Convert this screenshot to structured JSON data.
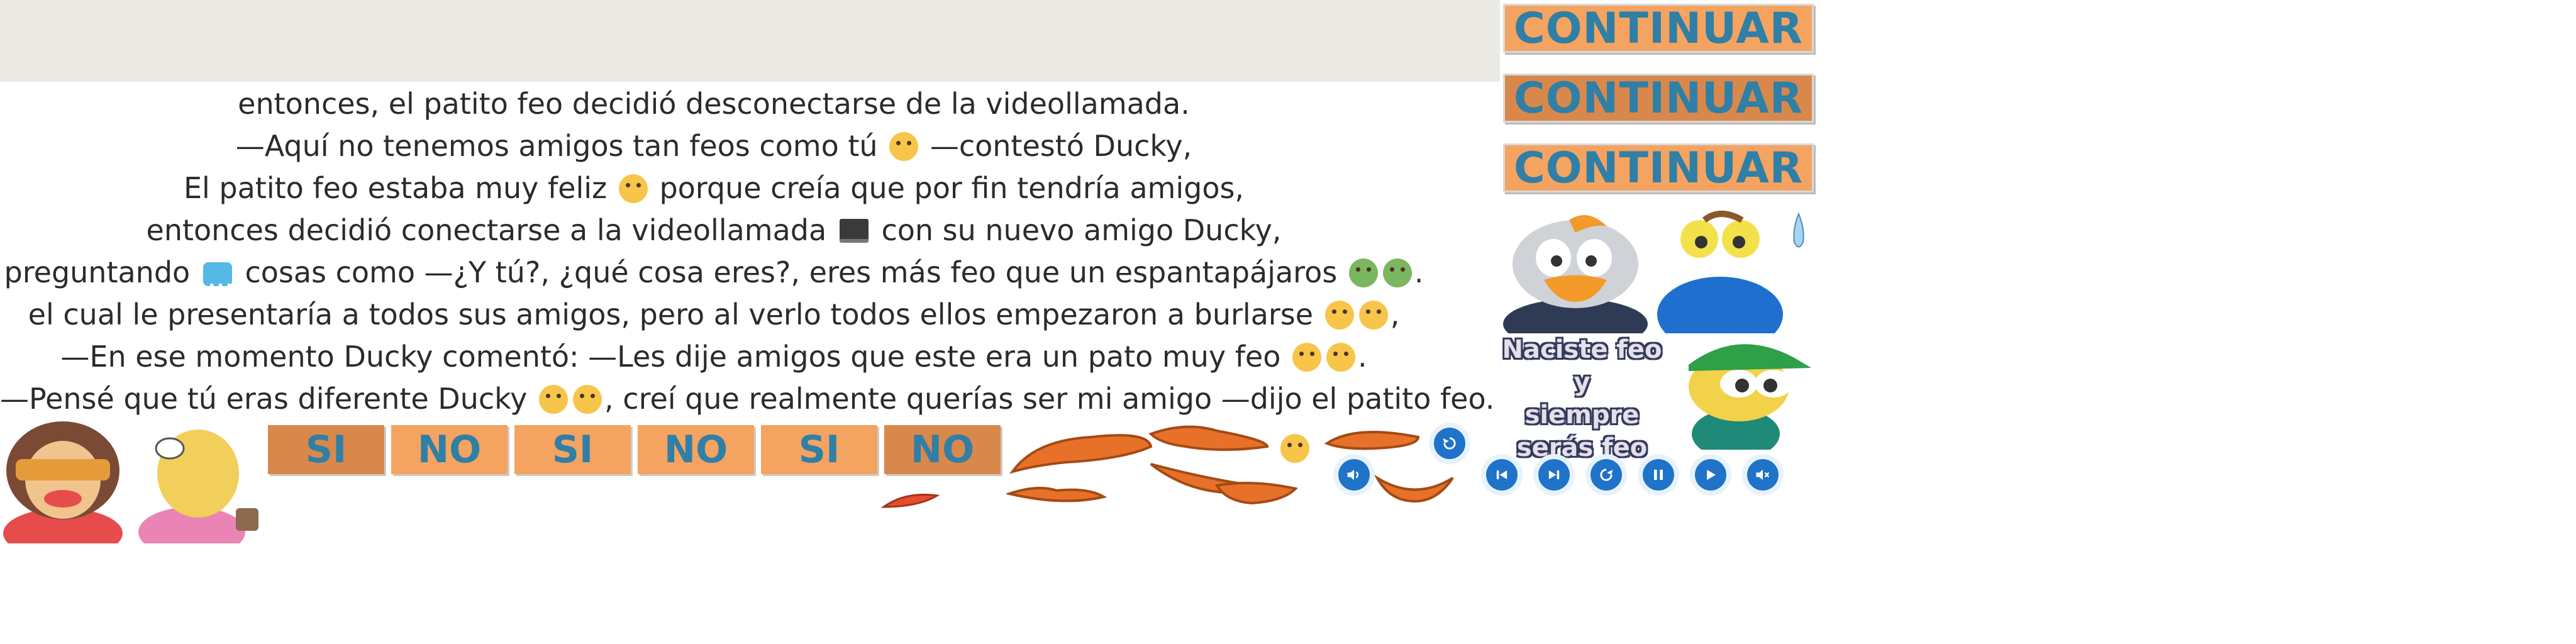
{
  "story": {
    "lines": [
      "entonces, el patito feo decidió desconectarse de la videollamada.",
      "—Aquí no tenemos amigos tan feos como tú",
      "—contestó Ducky,",
      "El patito feo estaba muy feliz",
      "porque creía que por fin tendría amigos,",
      "entonces decidió conectarse a la videollamada",
      "con su nuevo amigo Ducky,",
      "preguntando",
      "cosas como —¿Y tú?, ¿qué cosa eres?, eres más feo que un espantapájaros",
      ".",
      "el cual le presentaría a todos sus amigos, pero al verlo todos ellos empezaron a burlarse",
      ",",
      "—En ese momento Ducky comentó: —Les dije amigos que este era un pato muy feo",
      ".",
      "—Pensé que tú eras diferente Ducky",
      ", creí que realmente querías ser mi amigo —dijo el patito feo."
    ]
  },
  "buttons": {
    "continuar": [
      "CONTINUAR",
      "CONTINUAR",
      "CONTINUAR"
    ],
    "answers": [
      "SI",
      "NO",
      "SI",
      "NO",
      "SI",
      "NO"
    ]
  },
  "speech_bubble": "Naciste feo y\nsiempre\nserás feo",
  "colors": {
    "orange_light": "#f4a360",
    "orange_dark": "#d9884c",
    "button_text": "#2f7fa6",
    "control_blue": "#1f73c8"
  },
  "icons": [
    "volume-icon",
    "restart-icon",
    "previous-icon",
    "next-icon",
    "replay-icon",
    "pause-icon",
    "play-icon",
    "mute-icon"
  ]
}
